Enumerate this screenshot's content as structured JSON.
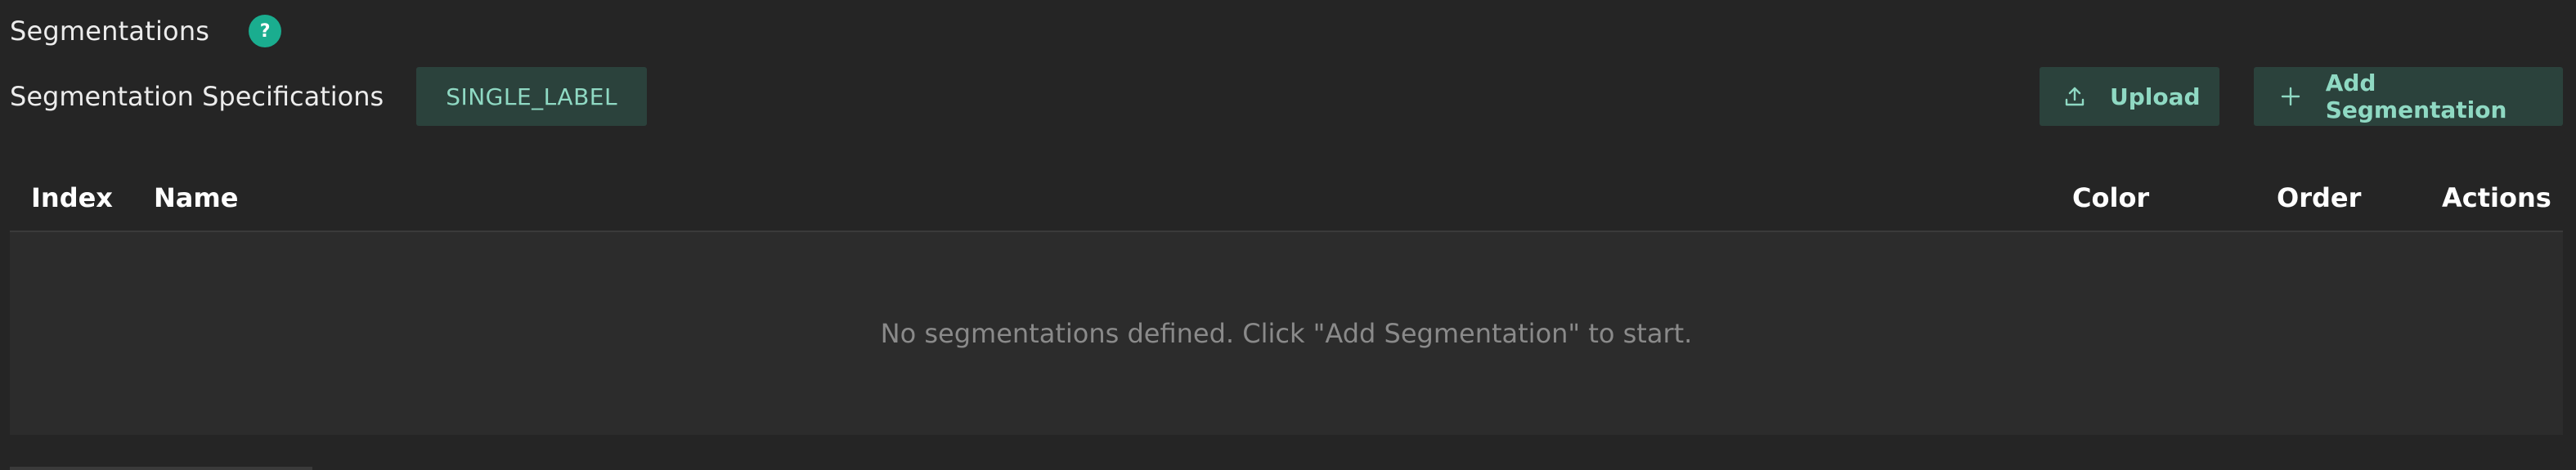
{
  "section": {
    "title": "Segmentations",
    "help_label": "?"
  },
  "specifications": {
    "label": "Segmentation Specifications",
    "type_value": "SINGLE_LABEL"
  },
  "actions": {
    "upload_label": "Upload",
    "upload_icon": "upload-icon",
    "add_label": "Add Segmentation",
    "add_icon": "plus-icon"
  },
  "table": {
    "columns": {
      "index": "Index",
      "name": "Name",
      "color": "Color",
      "order": "Order",
      "actions": "Actions"
    },
    "rows": [],
    "empty_message": "No segmentations defined. Click \"Add Segmentation\" to start."
  },
  "colors": {
    "accent": "#1aad8f",
    "button_bg": "#2b423c",
    "button_text": "#8fd9c3",
    "background": "#252525",
    "table_body_bg": "#2c2c2c"
  }
}
